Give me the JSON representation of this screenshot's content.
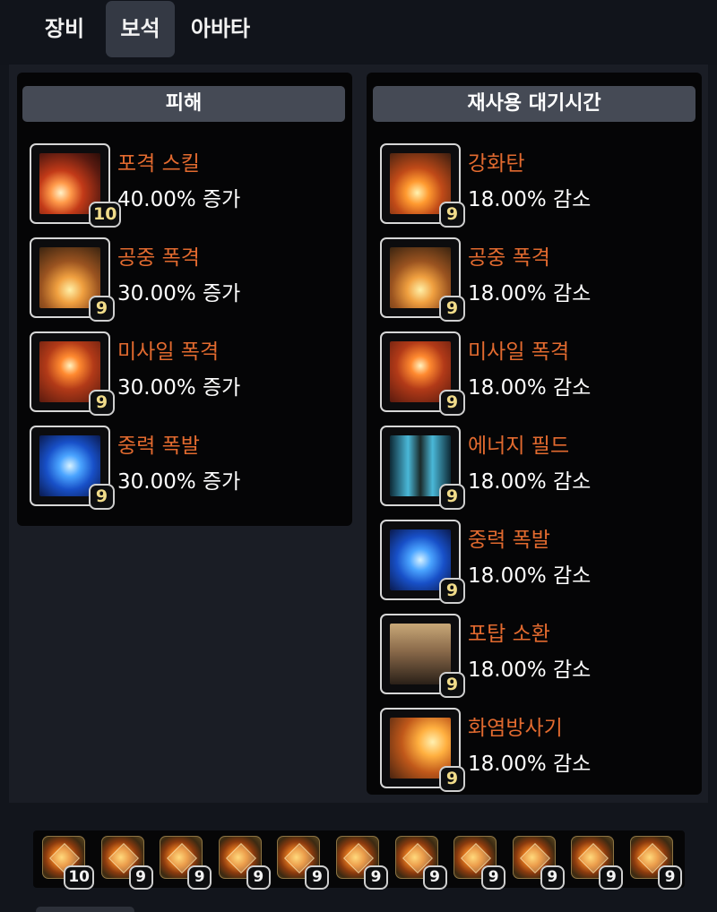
{
  "tabs": [
    {
      "label": "장비",
      "active": false
    },
    {
      "label": "보석",
      "active": true
    },
    {
      "label": "아바타",
      "active": false
    }
  ],
  "damage_panel": {
    "title": "피해",
    "skills": [
      {
        "name": "포격 스킬",
        "effect": "40.00% 증가",
        "level": "10",
        "icon": "bombard-skill-icon"
      },
      {
        "name": "공중 폭격",
        "effect": "30.00% 증가",
        "level": "9",
        "icon": "air-strike-icon"
      },
      {
        "name": "미사일 폭격",
        "effect": "30.00% 증가",
        "level": "9",
        "icon": "missile-barrage-icon"
      },
      {
        "name": "중력 폭발",
        "effect": "30.00% 증가",
        "level": "9",
        "icon": "gravity-explosion-icon"
      }
    ]
  },
  "cooldown_panel": {
    "title": "재사용 대기시간",
    "skills": [
      {
        "name": "강화탄",
        "effect": "18.00% 감소",
        "level": "9",
        "icon": "enhanced-shell-icon"
      },
      {
        "name": "공중 폭격",
        "effect": "18.00% 감소",
        "level": "9",
        "icon": "air-strike-icon"
      },
      {
        "name": "미사일 폭격",
        "effect": "18.00% 감소",
        "level": "9",
        "icon": "missile-barrage-icon"
      },
      {
        "name": "에너지 필드",
        "effect": "18.00% 감소",
        "level": "9",
        "icon": "energy-field-icon"
      },
      {
        "name": "중력 폭발",
        "effect": "18.00% 감소",
        "level": "9",
        "icon": "gravity-explosion-icon"
      },
      {
        "name": "포탑 소환",
        "effect": "18.00% 감소",
        "level": "9",
        "icon": "turret-summon-icon"
      },
      {
        "name": "화염방사기",
        "effect": "18.00% 감소",
        "level": "9",
        "icon": "flamethrower-icon"
      }
    ]
  },
  "gems": [
    {
      "level": "10"
    },
    {
      "level": "9"
    },
    {
      "level": "9"
    },
    {
      "level": "9"
    },
    {
      "level": "9"
    },
    {
      "level": "9"
    },
    {
      "level": "9"
    },
    {
      "level": "9"
    },
    {
      "level": "9"
    },
    {
      "level": "9"
    },
    {
      "level": "9"
    }
  ],
  "colors": {
    "skill_name": "#e26a2f",
    "level_badge": "#f1dc8a",
    "panel_header": "#454a55",
    "active_tab": "#343944"
  }
}
